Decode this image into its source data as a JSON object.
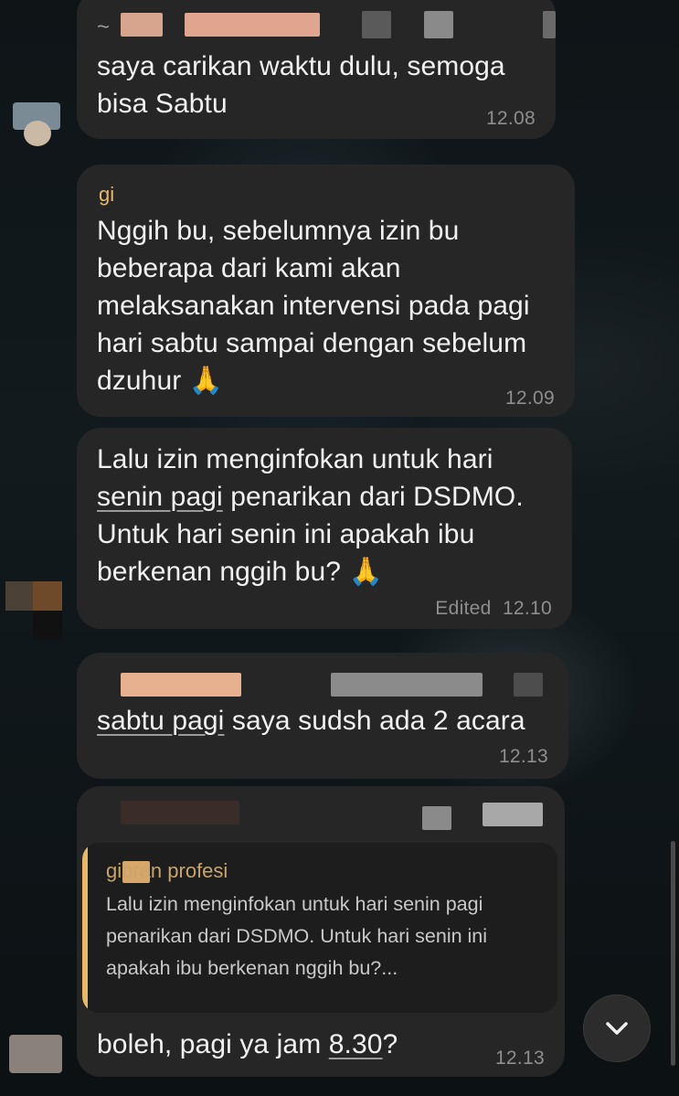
{
  "messages": [
    {
      "sender": "~",
      "text": "saya carikan waktu dulu, semoga\nbisa Sabtu",
      "time": "12.08"
    },
    {
      "sender": "gi",
      "line1": "Nggih bu, sebelumnya izin bu",
      "line2": "beberapa dari kami akan",
      "line3": "melaksanakan intervensi pada pagi",
      "line4": "hari sabtu sampai dengan sebelum",
      "line5": "dzuhur",
      "emoji": "🙏",
      "time": "12.09"
    },
    {
      "line1": "Lalu izin menginfokan untuk hari",
      "line2_underlined": "senin pagi",
      "line2_rest": " penarikan dari DSDMO.",
      "line3": "Untuk hari senin ini apakah ibu",
      "line4": "berkenan nggih bu?",
      "emoji": "🙏",
      "edited": "Edited",
      "time": "12.10"
    },
    {
      "underlined": "sabtu pagi",
      "rest": " saya sudsh ada 2 acara",
      "time": "12.13"
    },
    {
      "quote": {
        "name": "gibran profesi",
        "text": "Lalu izin menginfokan untuk hari senin pagi penarikan dari DSDMO. Untuk hari senin ini apakah ibu berkenan nggih bu?..."
      },
      "text_before": "boleh, pagi ya jam ",
      "underlined": "8.30",
      "text_after": "?",
      "time": "12.13"
    }
  ],
  "scroll_button": {
    "icon": "chevron-down-icon"
  },
  "colors": {
    "bubble": "#262626",
    "accent": "#e8b86a",
    "time": "#8e8e8e"
  }
}
